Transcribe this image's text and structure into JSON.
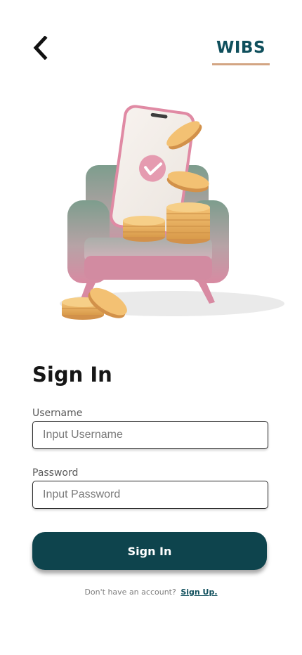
{
  "header": {
    "back_icon": "chevron-left-icon",
    "brand": "WIBS",
    "brand_color": "#0f4f5c",
    "brand_underline_color": "#d3a583"
  },
  "hero": {
    "illustration": "phone-on-armchair-with-coins"
  },
  "form": {
    "title": "Sign In",
    "username_label": "Username",
    "username_placeholder": "Input Username",
    "password_label": "Password",
    "password_placeholder": "Input Password",
    "submit_label": "Sign In",
    "button_color": "#0e444d"
  },
  "footer": {
    "prompt": "Don't have an account?",
    "link": "Sign Up."
  }
}
